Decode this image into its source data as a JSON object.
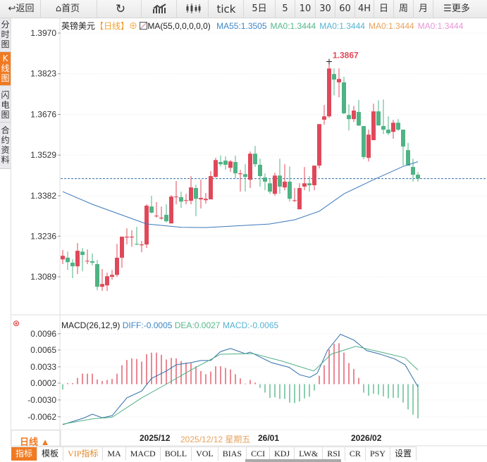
{
  "toolbar": {
    "back": "返回",
    "home": "首页",
    "tick": "tick",
    "five_day": "5日",
    "periods": [
      "5",
      "10",
      "30",
      "60",
      "4H",
      "日",
      "周",
      "月"
    ],
    "more": "更多"
  },
  "sidebar": {
    "items": [
      "分时图",
      "K线图",
      "闪电图",
      "合约资料"
    ],
    "active": 1
  },
  "header": {
    "symbol": "英镑美元",
    "period": "【日线】",
    "ma_params": "MA(55,0,0,0,0,0)",
    "ma_values": [
      {
        "text": "MA55:1.3505",
        "color": "#3d86c6"
      },
      {
        "text": "MA0:1.3444",
        "color": "#55b889"
      },
      {
        "text": "MA0:1.3444",
        "color": "#56b2d0"
      },
      {
        "text": "MA0:1.3444",
        "color": "#e8a25c"
      },
      {
        "text": "MA0:1.3444",
        "color": "#e596d8"
      }
    ]
  },
  "macd_header": {
    "title": "MACD(26,12,9)",
    "diff": "DIFF:-0.0005",
    "dea": "DEA:0.0027",
    "macd": "MACD:-0.0065"
  },
  "colors": {
    "up": "#e0485a",
    "down": "#4fb384",
    "ma55": "#3b78b8",
    "diff": "#2f6fa8",
    "dea": "#4fae86",
    "accent": "#f07a22",
    "last_line": "#2f6fa8"
  },
  "chart_data": [
    {
      "type": "candlestick",
      "price_ticks": [
        "1.3970",
        "1.3823",
        "1.3676",
        "1.3529",
        "1.3382",
        "1.3236",
        "1.3089"
      ],
      "high_label": "1.3867",
      "last_price": 1.3444,
      "ohlc": [
        [
          1.3152,
          1.3186,
          1.3135,
          1.3165
        ],
        [
          1.3158,
          1.318,
          1.3114,
          1.3142
        ],
        [
          1.314,
          1.3152,
          1.3084,
          1.3127
        ],
        [
          1.3127,
          1.3211,
          1.3099,
          1.3183
        ],
        [
          1.318,
          1.3193,
          1.3109,
          1.3168
        ],
        [
          1.3145,
          1.3188,
          1.3135,
          1.3147
        ],
        [
          1.3145,
          1.3173,
          1.313,
          1.314
        ],
        [
          1.3135,
          1.315,
          1.304,
          1.3053
        ],
        [
          1.3053,
          1.3117,
          1.3038,
          1.3063
        ],
        [
          1.3058,
          1.3104,
          1.3038,
          1.3091
        ],
        [
          1.3089,
          1.3114,
          1.3079,
          1.3096
        ],
        [
          1.3096,
          1.3208,
          1.3089,
          1.3158
        ],
        [
          1.3158,
          1.3234,
          1.3122,
          1.3234
        ],
        [
          1.3231,
          1.3264,
          1.3206,
          1.3234
        ],
        [
          1.3231,
          1.3257,
          1.3198,
          1.3234
        ],
        [
          1.3208,
          1.327,
          1.3203,
          1.3206
        ],
        [
          1.3203,
          1.3219,
          1.3178,
          1.3206
        ],
        [
          1.3206,
          1.3351,
          1.3193,
          1.3346
        ],
        [
          1.3343,
          1.3382,
          1.3318,
          1.3321
        ],
        [
          1.3308,
          1.3359,
          1.3303,
          1.331
        ],
        [
          1.33,
          1.3343,
          1.3295,
          1.3303
        ],
        [
          1.3313,
          1.3351,
          1.3285,
          1.329
        ],
        [
          1.3282,
          1.3384,
          1.3282,
          1.3379
        ],
        [
          1.3377,
          1.3435,
          1.3351,
          1.3379
        ],
        [
          1.3377,
          1.3397,
          1.3338,
          1.3361
        ],
        [
          1.3364,
          1.3389,
          1.3351,
          1.3366
        ],
        [
          1.3364,
          1.3453,
          1.3351,
          1.3412
        ],
        [
          1.341,
          1.3422,
          1.3308,
          1.3371
        ],
        [
          1.3369,
          1.344,
          1.3336,
          1.3374
        ],
        [
          1.3366,
          1.3392,
          1.3354,
          1.3371
        ],
        [
          1.3369,
          1.3471,
          1.3369,
          1.3453
        ],
        [
          1.345,
          1.3519,
          1.3448,
          1.3511
        ],
        [
          1.3504,
          1.3527,
          1.3488,
          1.3496
        ],
        [
          1.3509,
          1.3524,
          1.3476,
          1.3494
        ],
        [
          1.3483,
          1.3511,
          1.3468,
          1.3506
        ],
        [
          1.3504,
          1.3527,
          1.3445,
          1.3463
        ],
        [
          1.346,
          1.3476,
          1.3397,
          1.3463
        ],
        [
          1.346,
          1.3496,
          1.3397,
          1.345
        ],
        [
          1.344,
          1.3542,
          1.341,
          1.3534
        ],
        [
          1.3534,
          1.3562,
          1.3486,
          1.3496
        ],
        [
          1.3494,
          1.3516,
          1.3415,
          1.3453
        ],
        [
          1.3448,
          1.3463,
          1.3402,
          1.3433
        ],
        [
          1.3427,
          1.3445,
          1.3389,
          1.3397
        ],
        [
          1.3389,
          1.3466,
          1.3382,
          1.3455
        ],
        [
          1.3455,
          1.3516,
          1.3389,
          1.3415
        ],
        [
          1.3412,
          1.3496,
          1.3402,
          1.3433
        ],
        [
          1.3433,
          1.3488,
          1.3361,
          1.3371
        ],
        [
          1.3364,
          1.341,
          1.3359,
          1.3366
        ],
        [
          1.3333,
          1.3427,
          1.3333,
          1.341
        ],
        [
          1.3415,
          1.3486,
          1.3402,
          1.3427
        ],
        [
          1.3427,
          1.3453,
          1.3397,
          1.342
        ],
        [
          1.342,
          1.3491,
          1.3402,
          1.3491
        ],
        [
          1.3491,
          1.3641,
          1.3481,
          1.3641
        ],
        [
          1.3657,
          1.371,
          1.3639,
          1.3669
        ],
        [
          1.3669,
          1.3867,
          1.3664,
          1.3842
        ],
        [
          1.3822,
          1.3842,
          1.3745,
          1.3802
        ],
        [
          1.3792,
          1.3842,
          1.3738,
          1.3804
        ],
        [
          1.3792,
          1.3812,
          1.3677,
          1.368
        ],
        [
          1.3674,
          1.3712,
          1.3618,
          1.3659
        ],
        [
          1.3659,
          1.3707,
          1.3649,
          1.369
        ],
        [
          1.3685,
          1.3728,
          1.3634,
          1.3636
        ],
        [
          1.3634,
          1.3631,
          1.3514,
          1.3522
        ],
        [
          1.3519,
          1.3621,
          1.3506,
          1.3603
        ],
        [
          1.3583,
          1.3715,
          1.3583,
          1.3687
        ],
        [
          1.3687,
          1.3727,
          1.3636,
          1.3636
        ],
        [
          1.3634,
          1.373,
          1.3605,
          1.3621
        ],
        [
          1.3621,
          1.3669,
          1.3601,
          1.3608
        ],
        [
          1.3613,
          1.3657,
          1.3588,
          1.3646
        ],
        [
          1.3646,
          1.3659,
          1.3616,
          1.3621
        ],
        [
          1.3621,
          1.3621,
          1.3491,
          1.356
        ],
        [
          1.3547,
          1.3573,
          1.3491,
          1.3491
        ],
        [
          1.3486,
          1.3516,
          1.3433,
          1.3458
        ],
        [
          1.3458,
          1.3468,
          1.3433,
          1.3444
        ]
      ],
      "ma55": [
        [
          0,
          1.3397
        ],
        [
          6,
          1.3351
        ],
        [
          17,
          1.328
        ],
        [
          24,
          1.3268
        ],
        [
          29,
          1.3267
        ],
        [
          42,
          1.328
        ],
        [
          47,
          1.3295
        ],
        [
          52,
          1.3326
        ],
        [
          57,
          1.3389
        ],
        [
          63,
          1.344
        ],
        [
          69,
          1.3488
        ],
        [
          72,
          1.3505
        ]
      ]
    },
    {
      "type": "macd",
      "ticks": [
        "0.0096",
        "0.0065",
        "0.0033",
        "0.0002",
        "-0.0030",
        "-0.0062"
      ],
      "histogram": [
        -0.001,
        0.0002,
        0.0002,
        0.0012,
        0.002,
        0.002,
        0.002,
        0.0009,
        0.0006,
        0.0008,
        0.001,
        0.002,
        0.0036,
        0.0046,
        0.0049,
        0.0048,
        0.0043,
        0.0057,
        0.006,
        0.006,
        0.0056,
        0.0047,
        0.005,
        0.0049,
        0.0044,
        0.0041,
        0.004,
        0.0034,
        0.0025,
        0.0019,
        0.0024,
        0.0034,
        0.0034,
        0.0031,
        0.0028,
        0.0019,
        0.0011,
        0.0001,
        0.0008,
        0.0003,
        -0.0007,
        -0.0016,
        -0.0026,
        -0.0025,
        -0.0028,
        -0.0028,
        -0.0035,
        -0.0036,
        -0.0033,
        -0.0027,
        -0.0024,
        -0.0012,
        0.0016,
        0.0036,
        0.0066,
        0.0077,
        0.0078,
        0.006,
        0.004,
        0.0029,
        0.0012,
        -0.0016,
        -0.0022,
        -0.0018,
        -0.002,
        -0.0023,
        -0.0027,
        -0.0026,
        -0.0026,
        -0.0035,
        -0.0048,
        -0.0058,
        -0.0065
      ],
      "diff": [
        [
          0,
          -0.0077
        ],
        [
          4.4,
          -0.0064
        ],
        [
          6,
          -0.0057
        ],
        [
          8,
          -0.0064
        ],
        [
          10,
          -0.006
        ],
        [
          13,
          -0.0026
        ],
        [
          16,
          -0.0013
        ],
        [
          18,
          0.0011
        ],
        [
          21,
          0.0025
        ],
        [
          23,
          0.0037
        ],
        [
          26,
          0.0041
        ],
        [
          28,
          0.0045
        ],
        [
          30,
          0.0045
        ],
        [
          32,
          0.0062
        ],
        [
          34,
          0.0068
        ],
        [
          37,
          0.0058
        ],
        [
          38,
          0.0061
        ],
        [
          42.3,
          0.0041
        ],
        [
          45.9,
          0.0032
        ],
        [
          48,
          0.0018
        ],
        [
          50.1,
          0.0013
        ],
        [
          51.6,
          0.0021
        ],
        [
          53.7,
          0.0065
        ],
        [
          56.3,
          0.0095
        ],
        [
          59,
          0.0084
        ],
        [
          61.6,
          0.0064
        ],
        [
          64.4,
          0.0057
        ],
        [
          67.3,
          0.0048
        ],
        [
          69.4,
          0.0037
        ],
        [
          72,
          -0.0005
        ]
      ],
      "dea": [
        [
          0,
          -0.0076
        ],
        [
          6,
          -0.0066
        ],
        [
          10,
          -0.0063
        ],
        [
          16,
          -0.0026
        ],
        [
          21,
          0.0
        ],
        [
          26,
          0.0027
        ],
        [
          32,
          0.0057
        ],
        [
          37,
          0.0058
        ],
        [
          38.7,
          0.0058
        ],
        [
          44.4,
          0.0044
        ],
        [
          50.9,
          0.0025
        ],
        [
          54.4,
          0.0057
        ],
        [
          59.4,
          0.0072
        ],
        [
          65.9,
          0.0058
        ],
        [
          69.4,
          0.005
        ],
        [
          72,
          0.0027
        ]
      ]
    }
  ],
  "footer": {
    "period_label": "日线 ▲",
    "dates": [
      {
        "text": "2025/12",
        "color": "#333"
      },
      {
        "text": "2025/12/12 星期五",
        "color": "#e8a25c"
      },
      {
        "text": "26/01",
        "color": "#333"
      },
      {
        "text": "2026/02",
        "color": "#333"
      }
    ],
    "tabs": [
      "指标",
      "模板",
      "VIP指标",
      "MA",
      "MACD",
      "BOLL",
      "VOL",
      "BIAS",
      "CCI",
      "KDJ",
      "LW&",
      "RSI",
      "CR",
      "PSY",
      "设置"
    ],
    "active_tab": 0
  }
}
